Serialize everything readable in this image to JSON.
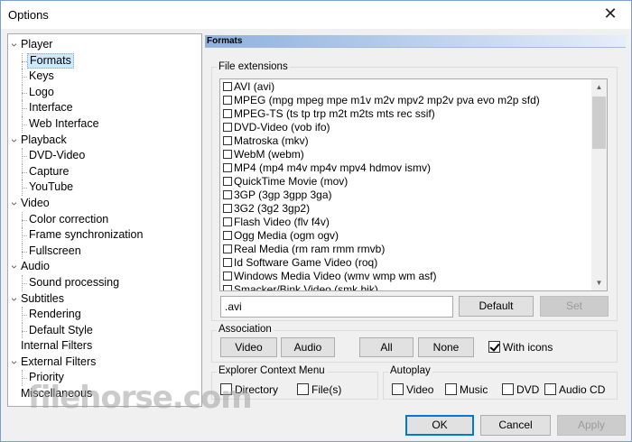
{
  "window": {
    "title": "Options",
    "close_glyph": "✕"
  },
  "tree": {
    "items": [
      {
        "label": "Player",
        "level": 0,
        "expander": true
      },
      {
        "label": "Formats",
        "level": 1,
        "selected": true
      },
      {
        "label": "Keys",
        "level": 1
      },
      {
        "label": "Logo",
        "level": 1
      },
      {
        "label": "Interface",
        "level": 1
      },
      {
        "label": "Web Interface",
        "level": 1
      },
      {
        "label": "Playback",
        "level": 0,
        "expander": true
      },
      {
        "label": "DVD-Video",
        "level": 1
      },
      {
        "label": "Capture",
        "level": 1
      },
      {
        "label": "YouTube",
        "level": 1
      },
      {
        "label": "Video",
        "level": 0,
        "expander": true
      },
      {
        "label": "Color correction",
        "level": 1
      },
      {
        "label": "Frame synchronization",
        "level": 1
      },
      {
        "label": "Fullscreen",
        "level": 1
      },
      {
        "label": "Audio",
        "level": 0,
        "expander": true
      },
      {
        "label": "Sound processing",
        "level": 1
      },
      {
        "label": "Subtitles",
        "level": 0,
        "expander": true
      },
      {
        "label": "Rendering",
        "level": 1
      },
      {
        "label": "Default Style",
        "level": 1
      },
      {
        "label": "Internal Filters",
        "level": 0
      },
      {
        "label": "External Filters",
        "level": 0,
        "expander": true
      },
      {
        "label": "Priority",
        "level": 1
      },
      {
        "label": "Miscellaneous",
        "level": 0
      }
    ]
  },
  "panel": {
    "header": "Formats"
  },
  "file_extensions": {
    "label": "File extensions",
    "items": [
      "AVI (avi)",
      "MPEG (mpg mpeg mpe m1v m2v mpv2 mp2v pva evo m2p sfd)",
      "MPEG-TS (ts tp trp m2t m2ts mts rec ssif)",
      "DVD-Video (vob ifo)",
      "Matroska (mkv)",
      "WebM (webm)",
      "MP4 (mp4 m4v mp4v mpv4 hdmov ismv)",
      "QuickTime Movie (mov)",
      "3GP (3gp 3gpp 3ga)",
      "3G2 (3g2 3gp2)",
      "Flash Video (flv f4v)",
      "Ogg Media (ogm ogv)",
      "Real Media (rm ram rmm rmvb)",
      "Id Software Game Video (roq)",
      "Windows Media Video (wmv wmp wm asf)",
      "Smacker/Bink Video (smk bik)"
    ],
    "edit_value": ".avi",
    "default_label": "Default",
    "set_label": "Set"
  },
  "association": {
    "label": "Association",
    "video_label": "Video",
    "audio_label": "Audio",
    "all_label": "All",
    "none_label": "None",
    "with_icons_label": "With icons",
    "with_icons_checked": true
  },
  "explorer_menu": {
    "label": "Explorer Context Menu",
    "directory_label": "Directory",
    "files_label": "File(s)"
  },
  "autoplay": {
    "label": "Autoplay",
    "video_label": "Video",
    "music_label": "Music",
    "dvd_label": "DVD",
    "audio_cd_label": "Audio CD"
  },
  "footer": {
    "ok_label": "OK",
    "cancel_label": "Cancel",
    "apply_label": "Apply"
  },
  "watermark": "filehorse.com"
}
